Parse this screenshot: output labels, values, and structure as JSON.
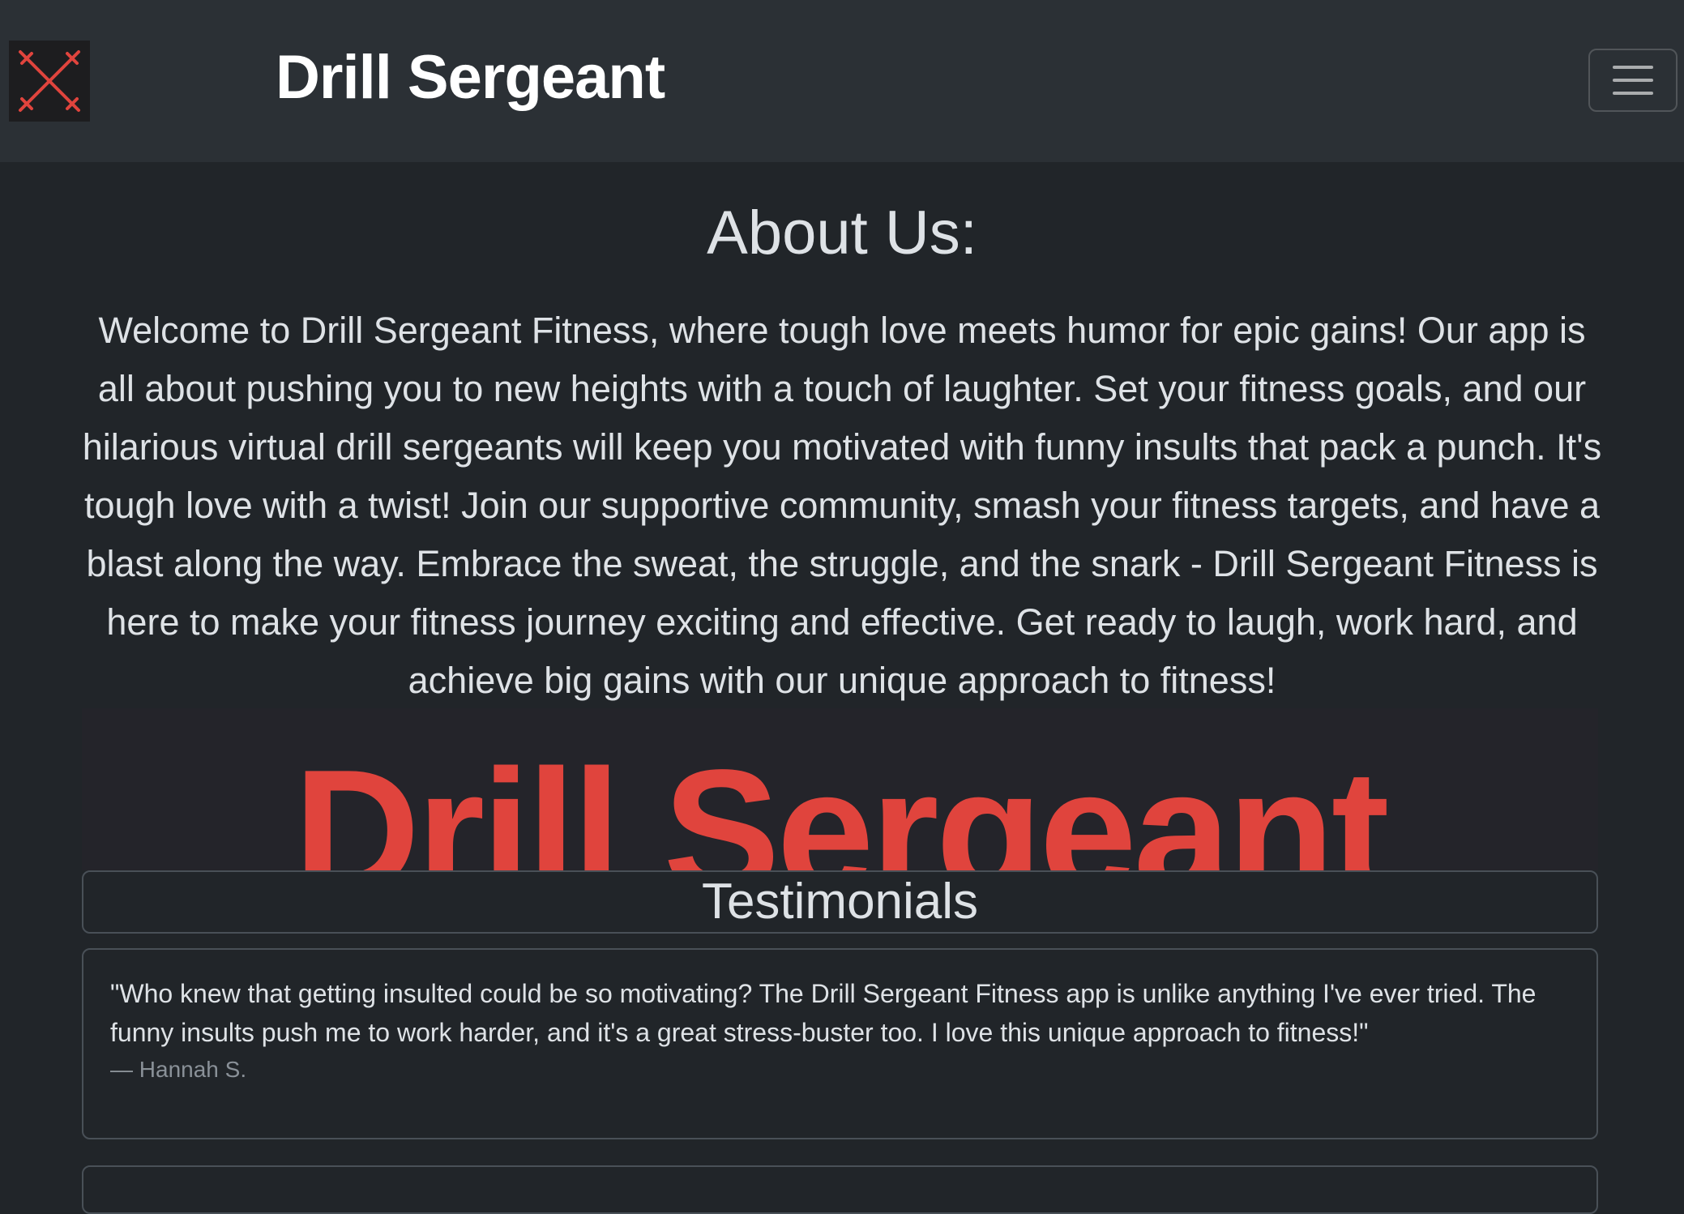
{
  "navbar": {
    "brand_title": "Drill Sergeant",
    "logo_icon": "crossed-arrows-logo",
    "menu_icon": "hamburger-menu-icon"
  },
  "about": {
    "heading": "About Us:",
    "text": "Welcome to Drill Sergeant Fitness, where tough love meets humor for epic gains! Our app is all about pushing you to new heights with a touch of laughter. Set your fitness goals, and our hilarious virtual drill sergeants will keep you motivated with funny insults that pack a punch. It's tough love with a twist! Join our supportive community, smash your fitness targets, and have a blast along the way. Embrace the sweat, the struggle, and the snark - Drill Sergeant Fitness is here to make your fitness journey exciting and effective. Get ready to laugh, work hard, and achieve big gains with our unique approach to fitness!"
  },
  "banner": {
    "text": "Drill Sergeant"
  },
  "testimonials": {
    "title": "Testimonials",
    "items": [
      {
        "quote": "\"Who knew that getting insulted could be so motivating? The Drill Sergeant Fitness app is unlike anything I've ever tried. The funny insults push me to work harder, and it's a great stress-buster too. I love this unique approach to fitness!\"",
        "author": "— Hannah S."
      }
    ]
  },
  "colors": {
    "page_bg": "#212529",
    "navbar_bg": "#2b3035",
    "accent_red": "#e0443d",
    "text": "#dee2e6",
    "muted": "#8a9198"
  }
}
